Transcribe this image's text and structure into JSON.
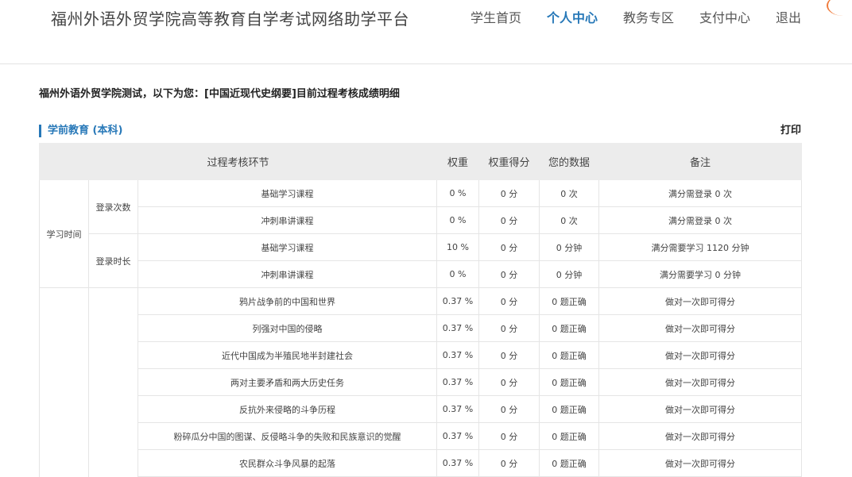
{
  "header": {
    "site_title": "福州外语外贸学院高等教育自学考试网络助学平台",
    "nav": [
      {
        "label": "学生首页",
        "active": false
      },
      {
        "label": "个人中心",
        "active": true
      },
      {
        "label": "教务专区",
        "active": false
      },
      {
        "label": "支付中心",
        "active": false
      },
      {
        "label": "退出",
        "active": false
      }
    ]
  },
  "intro_text": "福州外语外贸学院测试，以下为您：[中国近现代史纲要]目前过程考核成绩明细",
  "section": {
    "title": "学前教育 (本科)",
    "print_label": "打印"
  },
  "table": {
    "headers": [
      "过程考核环节",
      "权重",
      "权重得分",
      "您的数据",
      "备注"
    ],
    "group_label": "学习时间",
    "subgroups": [
      {
        "label": "登录次数",
        "rows": [
          {
            "item": "基础学习课程",
            "weight": "0 %",
            "score": "0 分",
            "data": "0 次",
            "note": "满分需登录 0 次"
          },
          {
            "item": "冲刺串讲课程",
            "weight": "0 %",
            "score": "0 分",
            "data": "0 次",
            "note": "满分需登录 0 次"
          }
        ]
      },
      {
        "label": "登录时长",
        "rows": [
          {
            "item": "基础学习课程",
            "weight": "10 %",
            "score": "0 分",
            "data": "0 分钟",
            "note": "满分需要学习 1120 分钟"
          },
          {
            "item": "冲刺串讲课程",
            "weight": "0 %",
            "score": "0 分",
            "data": "0 分钟",
            "note": "满分需要学习 0 分钟"
          }
        ]
      }
    ],
    "exercise_rows": [
      {
        "item": "鸦片战争前的中国和世界",
        "weight": "0.37 %",
        "score": "0 分",
        "data": "0 题正确",
        "note": "做对一次即可得分"
      },
      {
        "item": "列强对中国的侵略",
        "weight": "0.37 %",
        "score": "0 分",
        "data": "0 题正确",
        "note": "做对一次即可得分"
      },
      {
        "item": "近代中国成为半殖民地半封建社会",
        "weight": "0.37 %",
        "score": "0 分",
        "data": "0 题正确",
        "note": "做对一次即可得分"
      },
      {
        "item": "两对主要矛盾和两大历史任务",
        "weight": "0.37 %",
        "score": "0 分",
        "data": "0 题正确",
        "note": "做对一次即可得分"
      },
      {
        "item": "反抗外来侵略的斗争历程",
        "weight": "0.37 %",
        "score": "0 分",
        "data": "0 题正确",
        "note": "做对一次即可得分"
      },
      {
        "item": "粉碎瓜分中国的图谋、反侵略斗争的失败和民族意识的觉醒",
        "weight": "0.37 %",
        "score": "0 分",
        "data": "0 题正确",
        "note": "做对一次即可得分"
      },
      {
        "item": "农民群众斗争风暴的起落",
        "weight": "0.37 %",
        "score": "0 分",
        "data": "0 题正确",
        "note": "做对一次即可得分"
      }
    ]
  },
  "colors": {
    "accent": "#2778b8",
    "header_bg": "#ececec",
    "deco": "#f07a3a"
  }
}
